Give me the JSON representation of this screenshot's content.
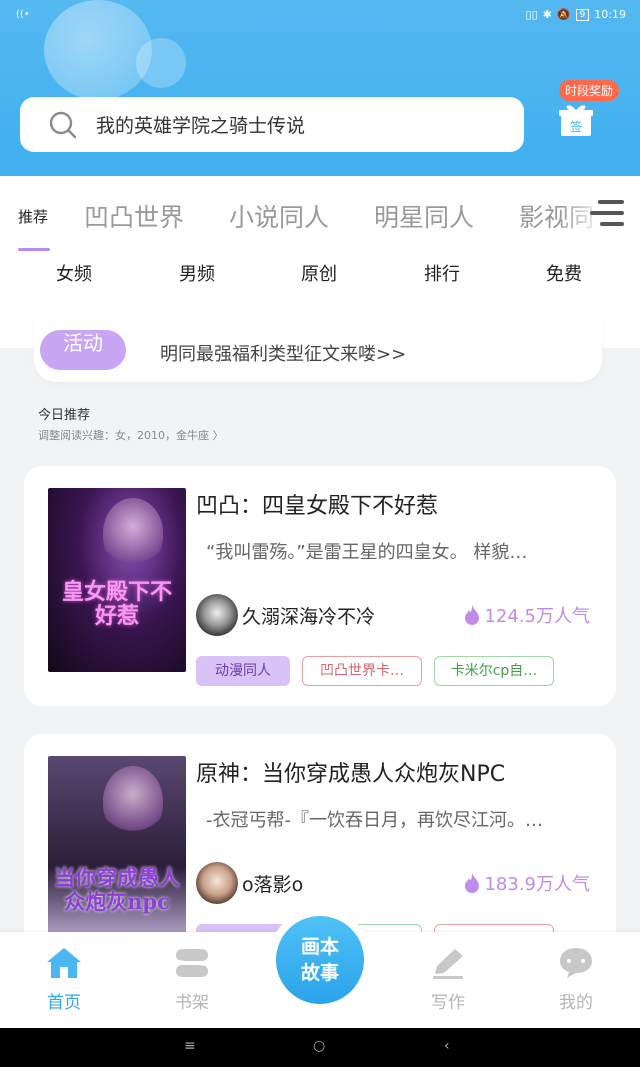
{
  "status_bar": {
    "time": "10:19",
    "battery": "9"
  },
  "search": {
    "text": "我的英雄学院之骑士传说"
  },
  "reward": {
    "label": "时段奖励",
    "sign_label": "签"
  },
  "tabs": [
    {
      "label": "推荐"
    },
    {
      "label": "凹凸世界"
    },
    {
      "label": "小说同人"
    },
    {
      "label": "明星同人"
    },
    {
      "label": "影视同"
    }
  ],
  "categories": [
    {
      "label": "女频"
    },
    {
      "label": "男频"
    },
    {
      "label": "原创"
    },
    {
      "label": "排行"
    },
    {
      "label": "免费"
    }
  ],
  "banner": {
    "pill": "活动",
    "text": "明同最强福利类型征文来喽>>"
  },
  "recommend": {
    "title": "今日推荐",
    "subtitle": "调整阅读兴趣：女，2010，金牛座 〉"
  },
  "books": [
    {
      "cover_title": "皇女殿下不好惹",
      "title": "凹凸：四皇女殿下不好惹",
      "desc": "“我叫雷殇。”是雷王星的四皇女。 样貌…",
      "author": "久溺深海冷不冷",
      "popularity": "124.5万人气",
      "tags": [
        "动漫同人",
        "凹凸世界卡…",
        "卡米尔cp自…"
      ]
    },
    {
      "cover_title": "当你穿成愚人众炮灰npc",
      "title": "原神：当你穿成愚人众炮灰NPC",
      "desc": "-衣冠丐帮-『一饮吞日月，再饮尽江河。…",
      "author": "o落影o",
      "popularity": "183.9万人气",
      "tags": [
        "",
        "",
        ""
      ]
    }
  ],
  "tabbar": {
    "home": "首页",
    "shelf": "书架",
    "center": "画本故事",
    "write": "写作",
    "mine": "我的"
  },
  "system_nav": {
    "menu": "≡",
    "home": "○",
    "back": "‹"
  },
  "colors": {
    "header": "#3fb0f0",
    "accent_purple": "#b58cf3",
    "active_blue": "#2fa6ea"
  }
}
